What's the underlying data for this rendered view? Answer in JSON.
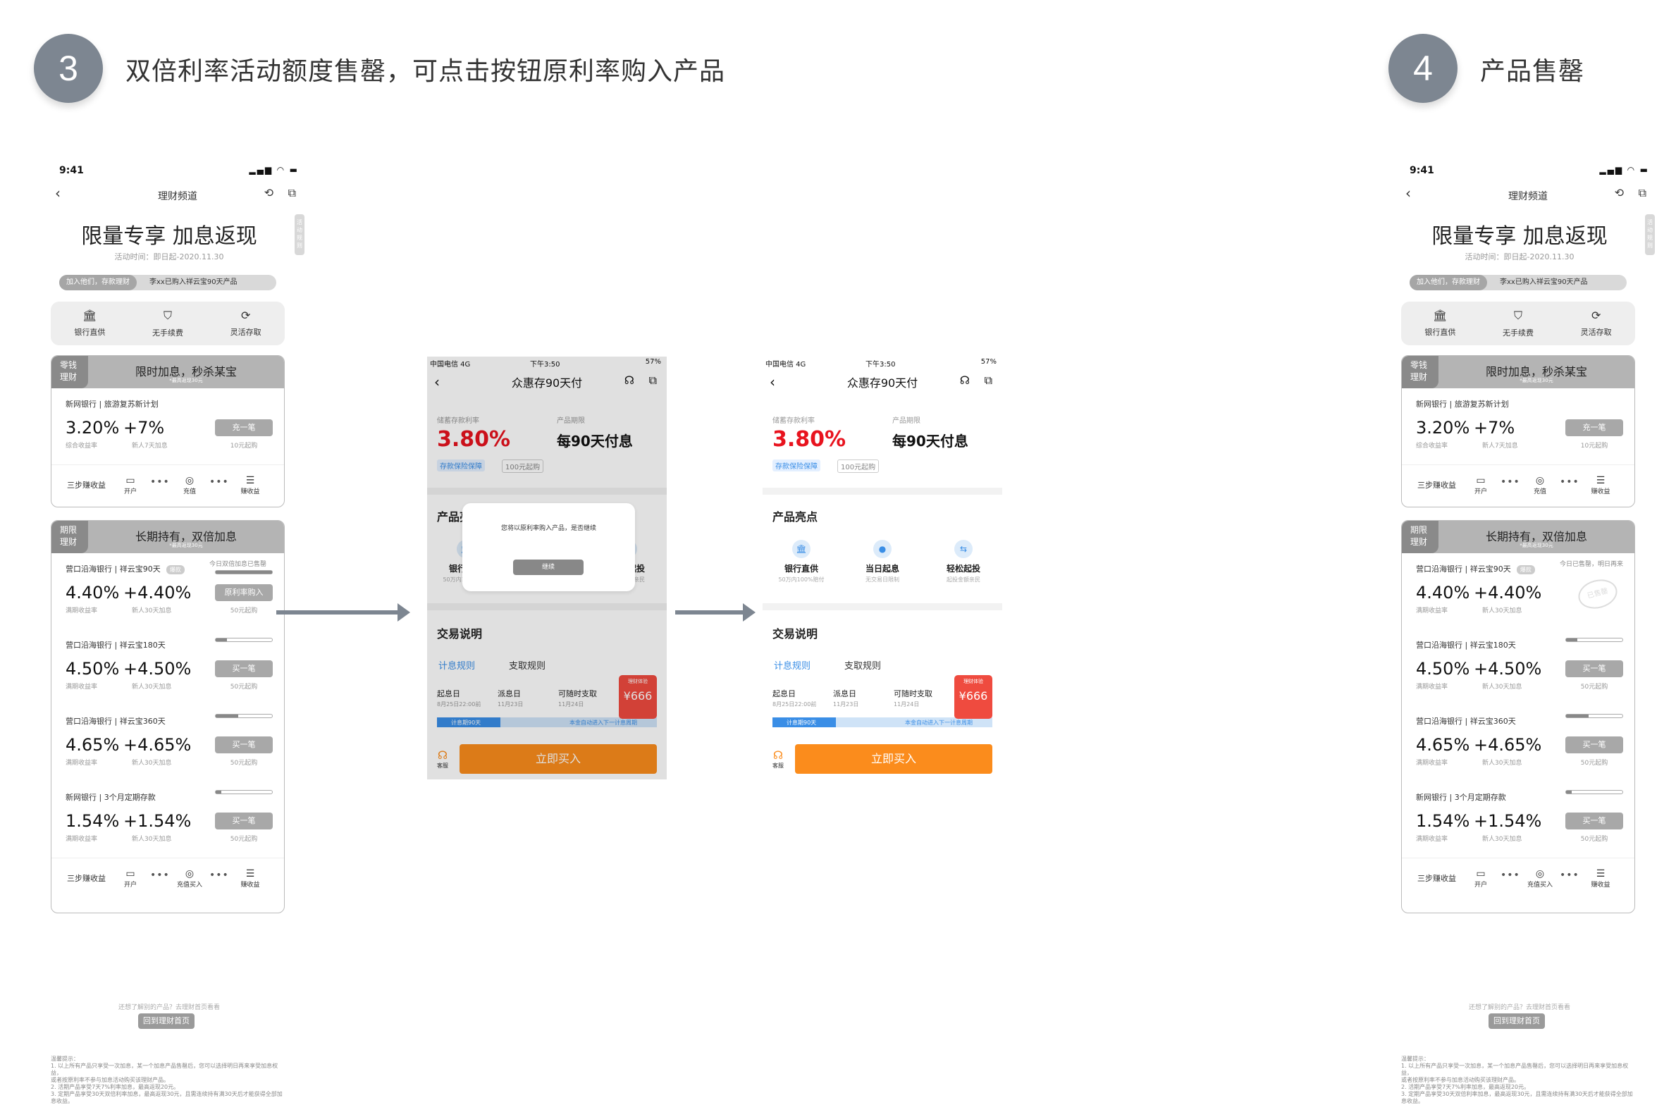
{
  "step3": {
    "num": "3",
    "title": "双倍利率活动额度售罄，可点击按钮原利率购入产品"
  },
  "step4": {
    "num": "4",
    "title": "产品售罄"
  },
  "phone": {
    "time": "9:41",
    "nav_title": "理财频道",
    "side": "活动规则",
    "big_title": "限量专享 加息返现",
    "activity_time": "活动时间：即日起-2020.11.30",
    "ticker_left": "加入他们，存款理财",
    "ticker_right": "李xx已购入祥云宝90天产品",
    "features": [
      {
        "icon": "🏛",
        "label": "银行直供"
      },
      {
        "icon": "⛉",
        "label": "无手续费"
      },
      {
        "icon": "⟳",
        "label": "灵活存取"
      }
    ],
    "card1": {
      "tag1": "零钱",
      "tag2": "理财",
      "title": "限时加息，秒杀某宝",
      "sub": "*最高返现30元",
      "bank": "新网银行 | 旅游复苏新计划",
      "rate": "3.20%",
      "add": "+7%",
      "rate_label": "综合收益率",
      "add_label": "新人7天加息",
      "btn": "充一笔",
      "min": "10元起购",
      "steps_label": "三步赚收益",
      "s1": "开户",
      "s2": "充值",
      "s3": "赚收益"
    },
    "card2": {
      "tag1": "期限",
      "tag2": "理财",
      "title": "长期持有，双倍加息",
      "sub": "*最高返现30元",
      "products": [
        {
          "bank": "营口沿海银行 | 祥云宝90天",
          "pill": "爆款",
          "rate": "4.40%",
          "add": "+4.40%",
          "note3": "今日双倍加息已售罄",
          "btn3": "原利率购入",
          "note4": "今日已售罄，明日再来",
          "sold": "已售罄",
          "min": "50元起购",
          "fill": 100
        },
        {
          "bank": "营口沿海银行 | 祥云宝180天",
          "rate": "4.50%",
          "add": "+4.50%",
          "btn": "买一笔",
          "min": "50元起购",
          "fill": 20
        },
        {
          "bank": "营口沿海银行 | 祥云宝360天",
          "rate": "4.65%",
          "add": "+4.65%",
          "btn": "买一笔",
          "min": "50元起购",
          "fill": 40
        },
        {
          "bank": "新网银行 | 3个月定期存款",
          "rate": "1.54%",
          "add": "+1.54%",
          "btn": "买一笔",
          "min": "50元起购",
          "fill": 10
        }
      ],
      "rate_label": "满期收益率",
      "add_label": "新人30天加息",
      "steps_label": "三步赚收益",
      "s1": "开户",
      "s2": "充值买入",
      "s3": "赚收益"
    },
    "foot1": "还想了解别的产品？去理财首页看看",
    "foot2": "回到理财首页",
    "tips": [
      "温馨提示：",
      "1. 以上所有产品只享受一次加息，某一个加息产品售罄后，您可以选择明日再来享受加息权益，",
      "或者按原利率不参与加息活动购买该理财产品。",
      "2. 活期产品享受7天7%利率加息，最高返现20元。",
      "3. 定期产品享受30天双倍利率加息，最高返现30元，且需连续持有满30天后才能获得全部加",
      "息收益。"
    ]
  },
  "detail": {
    "carrier": "中国电信  4G",
    "time": "下午3:50",
    "battery": "57%",
    "title": "众惠存90天付",
    "rate_label": "储蓄存款利率",
    "period_label": "产品期限",
    "rate": "3.80%",
    "period": "每90天付息",
    "badge1": "存款保险保障",
    "badge2": "100元起购",
    "highlights_title": "产品亮点",
    "highlights": [
      {
        "icon": "🏛",
        "t": "银行直供",
        "s": "50万内100%赔付"
      },
      {
        "icon": "●",
        "t": "当日起息",
        "s": "无交易日限制"
      },
      {
        "icon": "⇆",
        "t": "轻松起投",
        "s": "起投金额亲民"
      }
    ],
    "trade_title": "交易说明",
    "tab1": "计息规则",
    "tab2": "支取规则",
    "timeline": [
      {
        "t": "起息日",
        "d": "8月25日22:00前"
      },
      {
        "t": "派息日",
        "d": "11月23日"
      },
      {
        "t": "可随时支取",
        "d": "11月24日"
      }
    ],
    "bar_left": "计息期90天",
    "bar_right": "本金自动进入下一计息周期",
    "red_top": "理财体验",
    "red_amount": "¥666",
    "buy": "立即买入",
    "service": "客服",
    "dialog_msg": "您将以原利率购入产品，是否继续",
    "dialog_ok": "继续"
  }
}
